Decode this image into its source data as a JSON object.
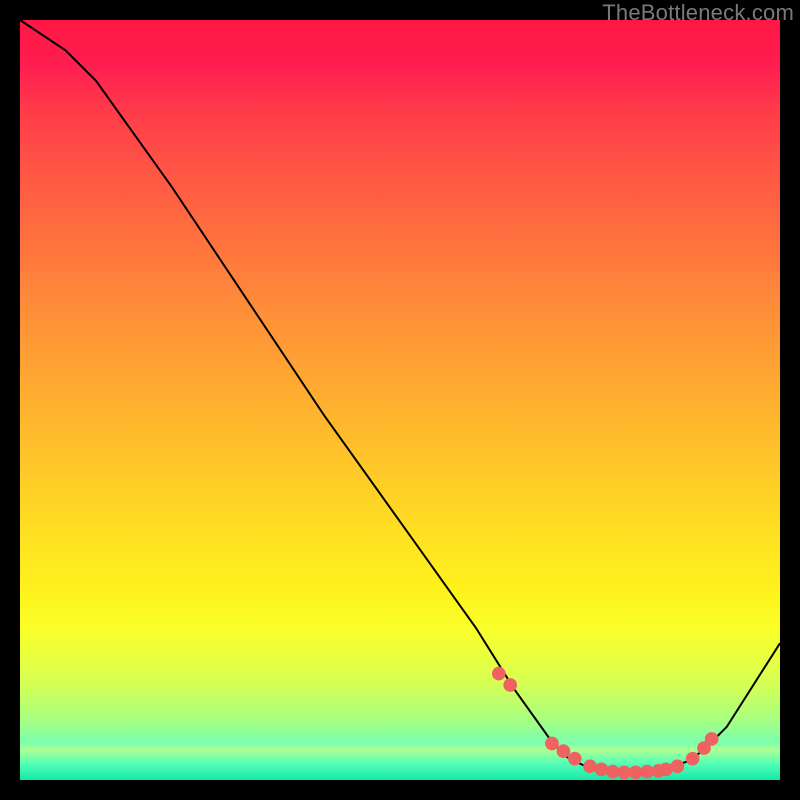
{
  "watermark": "TheBottleneck.com",
  "chart_data": {
    "type": "line",
    "title": "",
    "xlabel": "",
    "ylabel": "",
    "xlim": [
      0,
      100
    ],
    "ylim": [
      0,
      100
    ],
    "series": [
      {
        "name": "bottleneck-curve",
        "x": [
          0,
          6,
          10,
          20,
          30,
          40,
          50,
          60,
          65,
          70,
          72,
          75,
          78,
          80,
          83,
          85,
          88,
          90,
          93,
          100
        ],
        "values": [
          100,
          96,
          92,
          78,
          63,
          48,
          34,
          20,
          12,
          5,
          3,
          1.5,
          1,
          1,
          1.2,
          1.5,
          2.5,
          4,
          7,
          18
        ]
      }
    ],
    "markers": {
      "name": "highlight-dots",
      "color": "#f06262",
      "x": [
        63,
        64.5,
        70,
        71.5,
        73,
        75,
        76.5,
        78,
        79.5,
        81,
        82.5,
        84,
        85,
        86.5,
        88.5,
        90,
        91
      ],
      "values": [
        14,
        12.5,
        4.8,
        3.8,
        2.8,
        1.8,
        1.4,
        1.1,
        1.0,
        1.0,
        1.1,
        1.2,
        1.4,
        1.8,
        2.8,
        4.2,
        5.4
      ]
    },
    "gradient_stops": [
      {
        "pos": 0,
        "color": "#ff1744"
      },
      {
        "pos": 50,
        "color": "#ffb52e"
      },
      {
        "pos": 80,
        "color": "#faff2a"
      },
      {
        "pos": 100,
        "color": "#00e8a8"
      }
    ]
  }
}
